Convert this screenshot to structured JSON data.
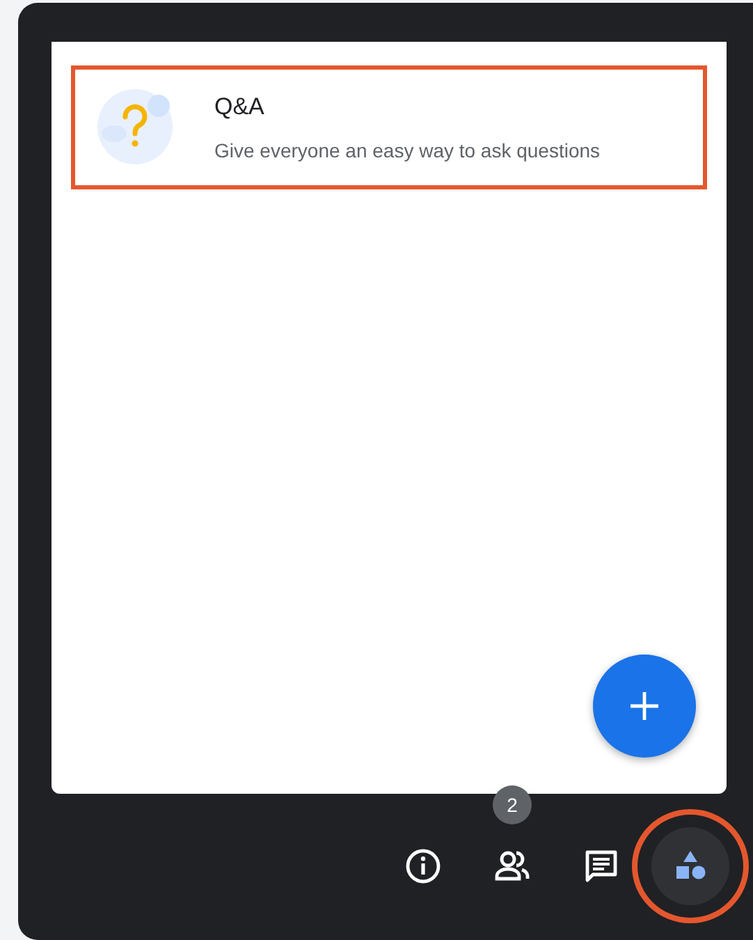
{
  "activities": [
    {
      "title": "Q&A",
      "description": "Give everyone an easy way to ask questions",
      "highlighted": true
    }
  ],
  "toolbar": [
    {
      "kind": "info",
      "selected": false,
      "highlighted": false
    },
    {
      "kind": "people",
      "badge": "2",
      "selected": false,
      "highlighted": false
    },
    {
      "kind": "chat",
      "selected": false,
      "highlighted": false
    },
    {
      "kind": "activities",
      "selected": true,
      "highlighted": true
    }
  ]
}
